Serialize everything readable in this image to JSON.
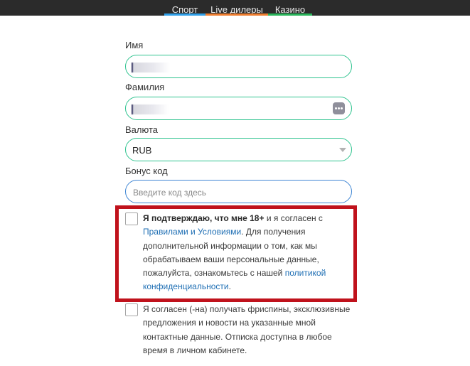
{
  "nav": {
    "tabs": [
      {
        "label": "Спорт",
        "color": "#2f9fe8"
      },
      {
        "label": "Live дилеры",
        "color": "#ee7d2f"
      },
      {
        "label": "Казино",
        "color": "#28b45a"
      }
    ]
  },
  "form": {
    "first_name_label": "Имя",
    "last_name_label": "Фамилия",
    "currency_label": "Валюта",
    "currency_value": "RUB",
    "bonus_label": "Бонус код",
    "bonus_placeholder": "Введите код здесь"
  },
  "consent_age": {
    "lead_bold": "Я подтверждаю, что мне 18+",
    "text1": " и я согласен с ",
    "link_terms": "Правилами и Условиями",
    "text2": ". Для получения дополнительной информации о том, как мы обрабатываем ваши персональные данные, пожалуйста, ознакомьтесь с нашей ",
    "link_privacy": "политикой конфиденциальности",
    "text3": ".",
    "highlight_color": "#c0121c"
  },
  "consent_marketing": {
    "text": "Я согласен (-на) получать фриспины, эксклюзивные предложения и новости на указанные мной контактные данные. Отписка доступна в любое время в личном кабинете."
  },
  "colors": {
    "accent_green": "#2fc38f",
    "focus_blue": "#3f86d4",
    "link_blue": "#1f6fb4"
  }
}
